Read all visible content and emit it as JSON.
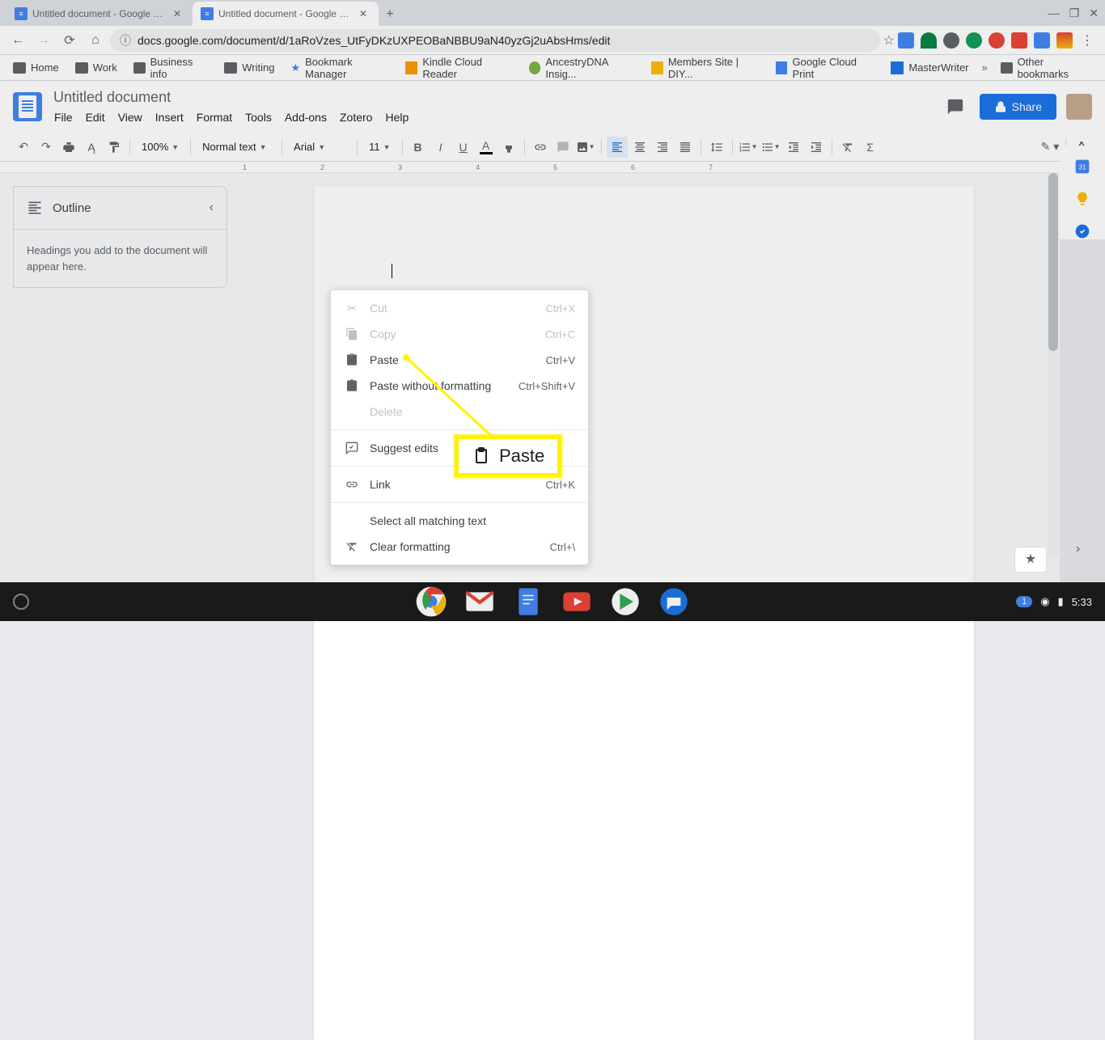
{
  "tabs": [
    {
      "title": "Untitled document - Google Docs"
    },
    {
      "title": "Untitled document - Google Docs"
    }
  ],
  "url": "docs.google.com/document/d/1aRoVzes_UtFyDKzUXPEOBaNBBU9aN40yzGj2uAbsHms/edit",
  "bookmarks": [
    {
      "label": "Home"
    },
    {
      "label": "Work"
    },
    {
      "label": "Business info"
    },
    {
      "label": "Writing"
    },
    {
      "label": "Bookmark Manager",
      "star": true
    },
    {
      "label": "Kindle Cloud Reader"
    },
    {
      "label": "AncestryDNA Insig..."
    },
    {
      "label": "Members Site | DIY..."
    },
    {
      "label": "Google Cloud Print"
    },
    {
      "label": "MasterWriter"
    },
    {
      "label": "Other bookmarks"
    }
  ],
  "doc": {
    "title": "Untitled document",
    "menus": [
      "File",
      "Edit",
      "View",
      "Insert",
      "Format",
      "Tools",
      "Add-ons",
      "Zotero",
      "Help"
    ],
    "share": "Share"
  },
  "toolbar": {
    "zoom": "100%",
    "style": "Normal text",
    "font": "Arial",
    "size": "11"
  },
  "outline": {
    "title": "Outline",
    "body": "Headings you add to the document will appear here."
  },
  "context_menu": [
    {
      "icon": "cut",
      "label": "Cut",
      "shortcut": "Ctrl+X",
      "disabled": true
    },
    {
      "icon": "copy",
      "label": "Copy",
      "shortcut": "Ctrl+C",
      "disabled": true
    },
    {
      "icon": "paste",
      "label": "Paste",
      "shortcut": "Ctrl+V"
    },
    {
      "icon": "paste",
      "label": "Paste without formatting",
      "shortcut": "Ctrl+Shift+V"
    },
    {
      "label": "Delete",
      "disabled": true
    },
    {
      "sep": true
    },
    {
      "icon": "suggest",
      "label": "Suggest edits"
    },
    {
      "sep": true
    },
    {
      "icon": "link",
      "label": "Link",
      "shortcut": "Ctrl+K"
    },
    {
      "sep": true
    },
    {
      "label": "Select all matching text"
    },
    {
      "icon": "clear",
      "label": "Clear formatting",
      "shortcut": "Ctrl+\\"
    }
  ],
  "callout": "Paste",
  "ruler_numbers": [
    "1",
    "2",
    "3",
    "4",
    "5",
    "6",
    "7"
  ],
  "shelf": {
    "notif": "1",
    "time": "5:33"
  }
}
